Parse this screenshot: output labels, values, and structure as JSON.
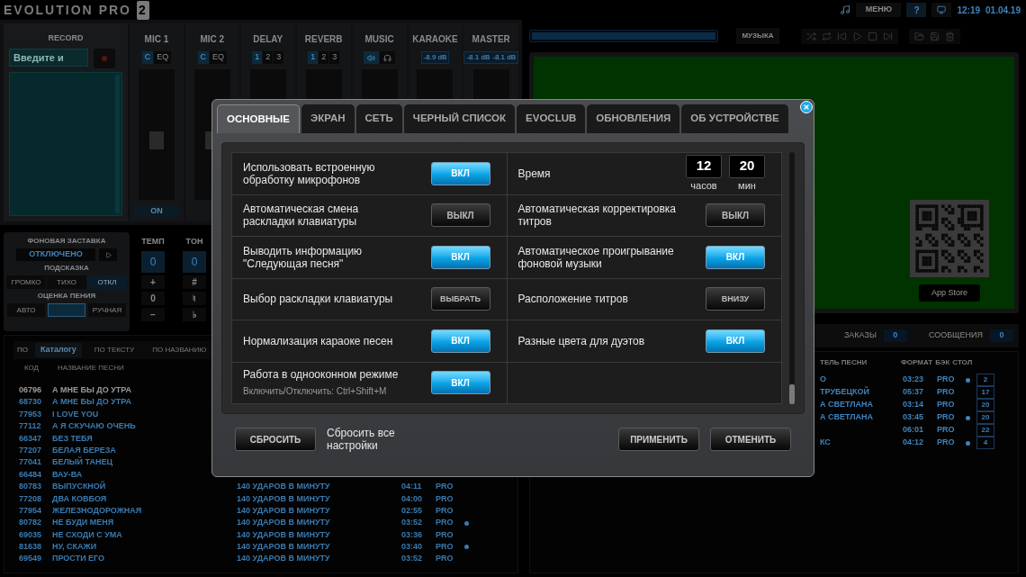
{
  "app": {
    "logo": "EVOLUTION",
    "logo_edition": "PRO",
    "logo_version": "2",
    "menu": "МЕНЮ",
    "help": "?",
    "time": "12:19",
    "date": "01.04.19"
  },
  "record": {
    "title": "RECORD",
    "placeholder": "Введите и"
  },
  "mixer": [
    {
      "name": "MIC 1",
      "kind": "buttons",
      "buttons": [
        {
          "text": "C",
          "selected": true
        },
        {
          "text": "EQ",
          "selected": false
        }
      ],
      "level": 0.45,
      "power": "ON"
    },
    {
      "name": "MIC 2",
      "kind": "buttons",
      "buttons": [
        {
          "text": "C",
          "selected": true
        },
        {
          "text": "EQ",
          "selected": false
        }
      ],
      "level": 0.45
    },
    {
      "name": "DELAY",
      "kind": "buttons",
      "buttons": [
        {
          "text": "1",
          "selected": true
        },
        {
          "text": "2",
          "selected": false
        },
        {
          "text": "3",
          "selected": false
        }
      ]
    },
    {
      "name": "REVERB",
      "kind": "buttons",
      "buttons": [
        {
          "text": "1",
          "selected": true
        },
        {
          "text": "2",
          "selected": false
        },
        {
          "text": "3",
          "selected": false
        }
      ]
    },
    {
      "name": "MUSIC",
      "kind": "outputs",
      "buttons": [
        {
          "selected": true
        },
        {
          "selected": false
        }
      ]
    },
    {
      "name": "KARAOKE",
      "kind": "readout",
      "readouts": [
        "-8.9 dB"
      ]
    },
    {
      "name": "MASTER",
      "kind": "readout",
      "readouts": [
        "-8.1 dB",
        "-8.1 dB"
      ]
    }
  ],
  "screensaver": {
    "title": "ФОНОВАЯ ЗАСТАВКА",
    "value": "ОТКЛЮЧЕНО"
  },
  "hint": {
    "title": "ПОДСКАЗКА",
    "options": [
      {
        "text": "ГРОМКО",
        "selected": false
      },
      {
        "text": "ТИХО",
        "selected": false
      },
      {
        "text": "ОТКЛ",
        "selected": true
      }
    ]
  },
  "rating": {
    "title": "ОЦЕНКА ПЕНИЯ",
    "options": [
      {
        "text": "АВТО",
        "selected": false
      },
      {
        "selected": true
      },
      {
        "text": "РУЧНАЯ",
        "selected": false
      }
    ]
  },
  "tempo": {
    "title": "ТЕМП",
    "value": "0",
    "keys": [
      "+",
      "0",
      "−"
    ]
  },
  "tone": {
    "title": "ТОН",
    "value": "0",
    "keys": [
      "#",
      "♮",
      "♭"
    ]
  },
  "catalog": {
    "search_label": "ПО",
    "tabs": [
      {
        "text": "Каталогу",
        "selected": true
      },
      {
        "text": "ПО ТЕКСТУ",
        "selected": false
      },
      {
        "text": "ПО НАЗВАНИЮ",
        "selected": false
      }
    ],
    "columns": [
      "КОД",
      "НАЗВАНИЕ ПЕСНИ"
    ],
    "rows": [
      {
        "code": "06796",
        "title": "А МНЕ БЫ ДО УТРА",
        "selected": true
      },
      {
        "code": "68730",
        "title": "А МНЕ БЫ ДО УТРА",
        "selected": false
      },
      {
        "code": "77953",
        "title": "I LOVE YOU",
        "selected": false
      },
      {
        "code": "77112",
        "title": "А Я СКУЧАЮ ОЧЕНЬ",
        "selected": false
      },
      {
        "code": "66347",
        "title": "БЕЗ ТЕБЯ",
        "selected": false
      },
      {
        "code": "77207",
        "title": "БЕЛАЯ БЕРЕЗА",
        "selected": false
      },
      {
        "code": "77041",
        "title": "БЕЛЫЙ ТАНЕЦ",
        "selected": false
      },
      {
        "code": "66484",
        "title": "ВАУ-ВА",
        "selected": false
      },
      {
        "code": "80783",
        "title": "ВЫПУСКНОЙ",
        "artist": "140 УДАРОВ В МИНУТУ",
        "duration": "04:11",
        "format": "PRO",
        "backing": false,
        "selected": false
      },
      {
        "code": "77208",
        "title": "ДВА КОВБОЯ",
        "artist": "140 УДАРОВ В МИНУТУ",
        "duration": "04:00",
        "format": "PRO",
        "backing": false,
        "selected": false
      },
      {
        "code": "77954",
        "title": "ЖЕЛЕЗНОДОРОЖНАЯ",
        "artist": "140 УДАРОВ В МИНУТУ",
        "duration": "02:55",
        "format": "PRO",
        "backing": false,
        "selected": false
      },
      {
        "code": "80782",
        "title": "НЕ БУДИ МЕНЯ",
        "artist": "140 УДАРОВ В МИНУТУ",
        "duration": "03:52",
        "format": "PRO",
        "backing": true,
        "selected": false
      },
      {
        "code": "69035",
        "title": "НЕ СХОДИ С УМА",
        "artist": "140 УДАРОВ В МИНУТУ",
        "duration": "03:36",
        "format": "PRO",
        "backing": false,
        "selected": false
      },
      {
        "code": "81638",
        "title": "НУ, СКАЖИ",
        "artist": "140 УДАРОВ В МИНУТУ",
        "duration": "03:40",
        "format": "PRO",
        "backing": true,
        "selected": false
      },
      {
        "code": "69549",
        "title": "ПРОСТИ ЕГО",
        "artist": "140 УДАРОВ В МИНУТУ",
        "duration": "03:52",
        "format": "PRO",
        "backing": false,
        "selected": false
      }
    ]
  },
  "player": {
    "music": "МУЗЫКА",
    "store": "App Store",
    "progress": {
      "level": 1
    }
  },
  "queue": {
    "orders": {
      "label": "ЗАКАЗЫ",
      "count": "0"
    },
    "messages": {
      "label": "СООБЩЕНИЯ",
      "count": "0"
    },
    "columns": [
      "ТЕЛЬ ПЕСНИ",
      "ФОРМАТ",
      "БЭК",
      "СТОЛ"
    ],
    "rows": [
      {
        "artist": "О",
        "duration": "03:23",
        "format": "PRO",
        "backing": true,
        "table": "2"
      },
      {
        "artist": "ТРУБЕЦКОЙ",
        "duration": "05:37",
        "format": "PRO",
        "backing": false,
        "table": "17"
      },
      {
        "artist": "А СВЕТЛАНА",
        "duration": "03:14",
        "format": "PRO",
        "backing": false,
        "table": "20"
      },
      {
        "artist": "А СВЕТЛАНА",
        "duration": "03:45",
        "format": "PRO",
        "backing": true,
        "table": "20"
      },
      {
        "duration": "06:01",
        "format": "PRO",
        "backing": false,
        "table": "22"
      },
      {
        "artist": "КС",
        "duration": "04:12",
        "format": "PRO",
        "backing": true,
        "table": "4"
      }
    ]
  },
  "dialog": {
    "tabs": [
      {
        "text": "ОСНОВНЫЕ",
        "selected": true
      },
      {
        "text": "ЭКРАН",
        "selected": false
      },
      {
        "text": "СЕТЬ",
        "selected": false
      },
      {
        "text": "ЧЕРНЫЙ СПИСОК",
        "selected": false
      },
      {
        "text": "EVOCLUB",
        "selected": false
      },
      {
        "text": "ОБНОВЛЕНИЯ",
        "selected": false
      },
      {
        "text": "ОБ УСТРОЙСТВЕ",
        "selected": false
      }
    ],
    "rows": [
      {
        "cells": [
          {
            "kind": "toggle",
            "label": "Использовать встроенную обработку микрофонов",
            "on": true,
            "text": "ВКЛ"
          },
          {
            "kind": "time",
            "label": "Время",
            "fields": [
              {
                "value": "12",
                "unit": "часов"
              },
              {
                "value": "20",
                "unit": "мин"
              }
            ]
          }
        ]
      },
      {
        "cells": [
          {
            "kind": "toggle",
            "label": "Автоматическая смена раскладки клавиатуры",
            "on": false,
            "text": "ВЫКЛ"
          },
          {
            "kind": "toggle",
            "label": "Автоматическая корректировка титров",
            "on": false,
            "text": "ВЫКЛ"
          }
        ]
      },
      {
        "cells": [
          {
            "kind": "toggle",
            "label": "Выводить информацию \"Следующая песня\"",
            "on": true,
            "text": "ВКЛ"
          },
          {
            "kind": "toggle",
            "label": "Автоматическое проигрывание фоновой музыки",
            "on": true,
            "text": "ВКЛ"
          }
        ]
      },
      {
        "cells": [
          {
            "kind": "choice",
            "label": "Выбор раскладки клавиатуры",
            "text": "ВЫБРАТЬ"
          },
          {
            "kind": "choice",
            "label": "Расположение титров",
            "text": "ВНИЗУ"
          }
        ]
      },
      {
        "cells": [
          {
            "kind": "toggle",
            "label": "Нормализация караоке песен",
            "on": true,
            "text": "ВКЛ"
          },
          {
            "kind": "toggle",
            "label": "Разные цвета для дуэтов",
            "on": true,
            "text": "ВКЛ"
          }
        ]
      },
      {
        "cells": [
          {
            "kind": "toggle",
            "label": "Работа в однооконном режиме",
            "hint": "Включить/Отключить: Ctrl+Shift+M",
            "on": true,
            "text": "ВКЛ"
          }
        ]
      }
    ],
    "reset": "СБРОСИТЬ",
    "reset_note": "Сбросить все настройки",
    "apply": "ПРИМЕНИТЬ",
    "cancel": "ОТМЕНИТЬ"
  }
}
